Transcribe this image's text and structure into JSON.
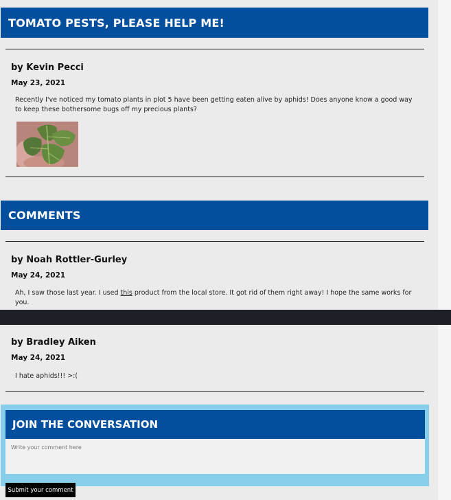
{
  "post": {
    "title": "TOMATO PESTS, PLEASE HELP ME!",
    "author": "by Kevin Pecci",
    "date": "May 23, 2021",
    "body": "Recently I've noticed my tomato plants in plot 5 have been getting eaten alive by aphids! Does anyone know a good way to keep these bothersome bugs off my precious plants?",
    "image_icon": "tomato-leaf-photo"
  },
  "comments_section": {
    "heading": "COMMENTS",
    "items": [
      {
        "author": "by Noah Rottler-Gurley",
        "date": "May 24, 2021",
        "body_before": "Ah, I saw those last year. I used ",
        "link_text": "this",
        "body_after": " product from the local store. It got rid of them right away! I hope the same works for you."
      },
      {
        "author": "by Bradley Aiken",
        "date": "May 24, 2021",
        "body": "I hate aphids!!! >:("
      }
    ]
  },
  "join": {
    "heading": "JOIN THE CONVERSATION",
    "placeholder": "Write your comment here",
    "submit_label": "Submit your comment"
  },
  "colors": {
    "banner": "#034f9e",
    "join_frame": "#87ceeb",
    "dark_bar": "#1e2028"
  }
}
